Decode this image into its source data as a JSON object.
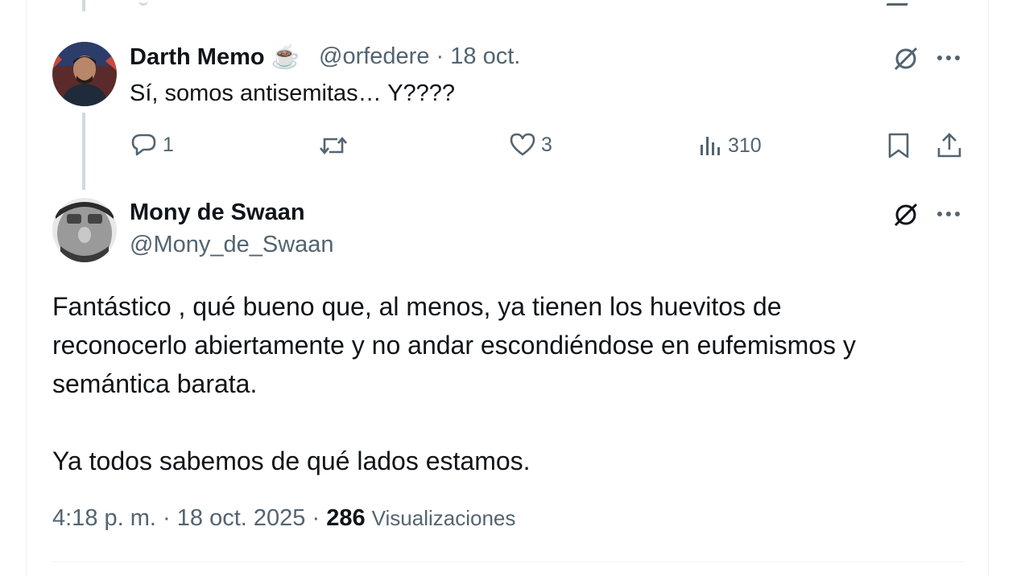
{
  "reply": {
    "author_name": "Darth Memo",
    "author_emoji": "☕",
    "handle": "@orfedere",
    "separator": "·",
    "date": "18 oct.",
    "text": "Sí, somos antisemitas… Y????",
    "counts": {
      "replies": "1",
      "reposts": "",
      "likes": "3",
      "views": "310"
    }
  },
  "main": {
    "author_name": "Mony de Swaan",
    "handle": "@Mony_de_Swaan",
    "paragraph1_line1": "Fantástico , qué bueno que, al menos, ya tienen los huevitos de",
    "paragraph1_line2": "reconocerlo abiertamente y no andar escondiéndose en eufemismos y",
    "paragraph1_line3": "semántica barata.",
    "paragraph2": "Ya todos sabemos de qué lados estamos.",
    "time": "4:18 p. m.",
    "date": "18 oct. 2025",
    "separator": "·",
    "views_count": "286",
    "views_label": "Visualizaciones"
  },
  "icons": {
    "reply": "reply-icon",
    "repost": "repost-icon",
    "like": "heart-icon",
    "views": "views-icon",
    "bookmark": "bookmark-icon",
    "share": "share-icon",
    "grok": "grok-icon",
    "more": "more-icon"
  },
  "colors": {
    "text": "#0f1419",
    "secondary": "#536471",
    "line": "#cfd9de",
    "border": "#eff3f4"
  }
}
